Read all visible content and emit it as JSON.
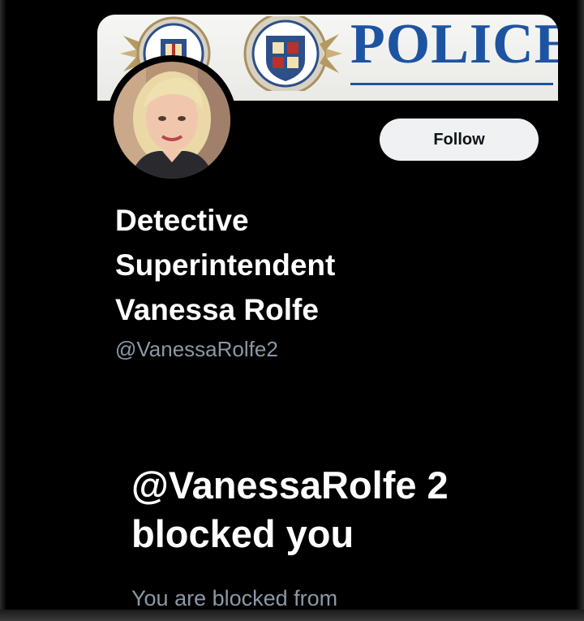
{
  "profile": {
    "banner_text": "POLICE",
    "display_name": "Detective Superintendent Vanessa Rolfe",
    "handle": "@VanessaRolfe2",
    "follow_label": "Follow"
  },
  "blocked_notice": {
    "heading": "@VanessaRolfe 2 blocked you",
    "subtext": "You are blocked from"
  },
  "icons": {
    "banner_crest": "police-crest-icon",
    "avatar": "profile-photo"
  },
  "colors": {
    "background": "#000000",
    "banner_text": "#1d54a2",
    "follow_button_bg": "#eff1f3",
    "primary_text": "#ffffff",
    "secondary_text": "#8b98a5"
  }
}
